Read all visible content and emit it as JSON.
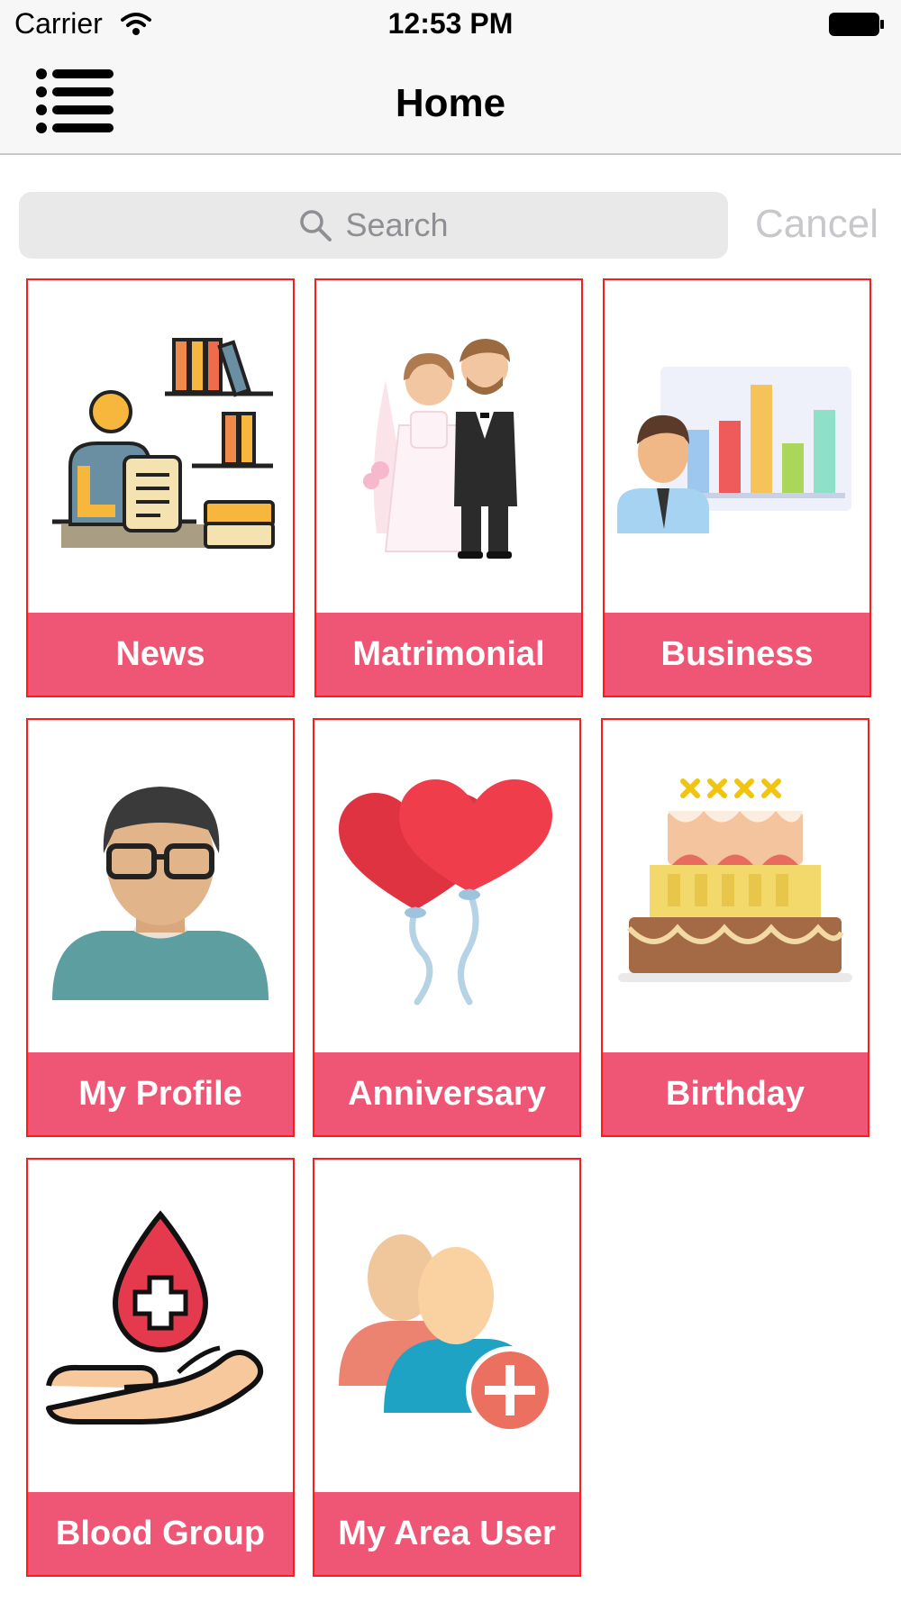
{
  "status_bar": {
    "carrier": "Carrier",
    "time": "12:53 PM",
    "icons": [
      "wifi-icon",
      "battery-icon"
    ]
  },
  "nav": {
    "title": "Home",
    "menu_icon": "list-menu-icon"
  },
  "search": {
    "placeholder": "Search",
    "cancel_label": "Cancel"
  },
  "tiles": [
    {
      "label": "News",
      "icon": "news-reader-icon"
    },
    {
      "label": "Matrimonial",
      "icon": "bride-groom-icon"
    },
    {
      "label": "Business",
      "icon": "business-chart-icon"
    },
    {
      "label": "My Profile",
      "icon": "profile-avatar-icon"
    },
    {
      "label": "Anniversary",
      "icon": "heart-balloons-icon"
    },
    {
      "label": "Birthday",
      "icon": "birthday-cake-icon"
    },
    {
      "label": "Blood Group",
      "icon": "blood-drop-hand-icon"
    },
    {
      "label": "My Area User",
      "icon": "add-users-icon"
    }
  ],
  "colors": {
    "tile_label_bg": "#ef5675",
    "tile_border": "#ff1a1a",
    "bar_bg": "#f7f7f7"
  }
}
